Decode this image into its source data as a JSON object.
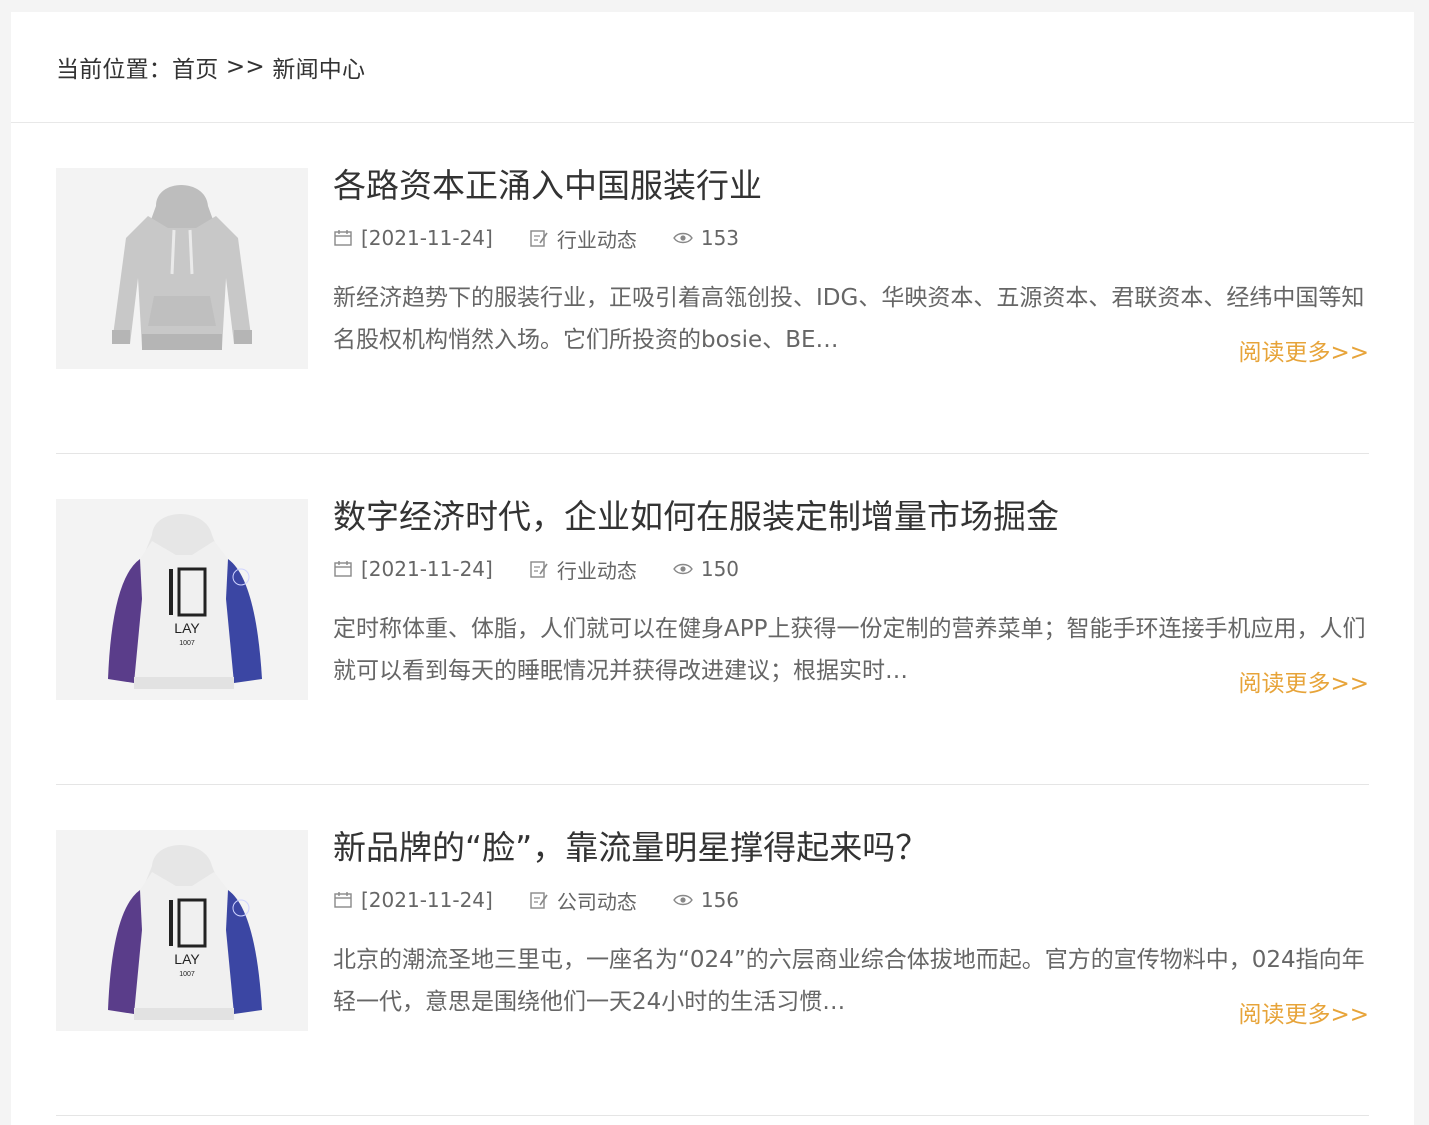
{
  "breadcrumb": {
    "prefix": "当前位置：",
    "home": "首页",
    "separator": ">>",
    "current": "新闻中心"
  },
  "colors": {
    "accent": "#e7a43a",
    "text": "#333333",
    "muted": "#666666"
  },
  "icons": {
    "date": "calendar-icon",
    "category": "edit-note-icon",
    "views": "eye-icon"
  },
  "articles": [
    {
      "title": "各路资本正涌入中国服装行业",
      "date": "[2021-11-24]",
      "category": "行业动态",
      "views": "153",
      "summary": "新经济趋势下的服装行业，正吸引着高瓴创投、IDG、华映资本、五源资本、君联资本、经纬中国等知名股权机构悄然入场。它们所投资的bosie、BE…",
      "more": "阅读更多>>",
      "image": "grey-hoodie"
    },
    {
      "title": "数字经济时代，企业如何在服装定制增量市场掘金",
      "date": "[2021-11-24]",
      "category": "行业动态",
      "views": "150",
      "summary": "定时称体重、体脂，人们就可以在健身APP上获得一份定制的营养菜单；智能手环连接手机应用，人们就可以看到每天的睡眠情况并获得改进建议；根据实时…",
      "more": "阅读更多>>",
      "image": "white-purple-hoodie"
    },
    {
      "title": "新品牌的“脸”，靠流量明星撑得起来吗？",
      "date": "[2021-11-24]",
      "category": "公司动态",
      "views": "156",
      "summary": "北京的潮流圣地三里屯，一座名为“024”的六层商业综合体拔地而起。官方的宣传物料中，024指向年轻一代，意思是围绕他们一天24小时的生活习惯…",
      "more": "阅读更多>>",
      "image": "white-purple-hoodie"
    }
  ]
}
